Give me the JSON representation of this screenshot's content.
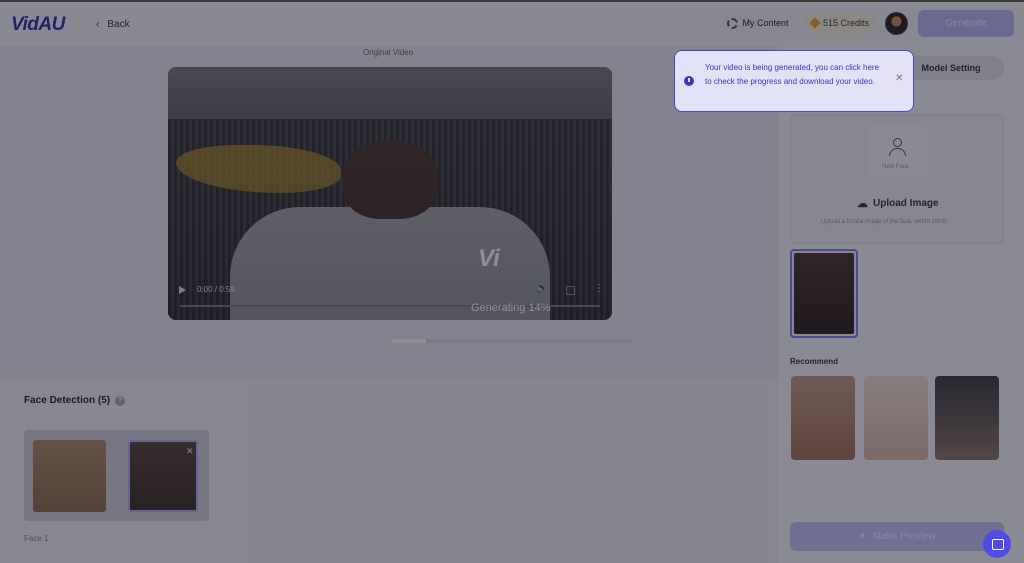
{
  "header": {
    "logo": "VidAU",
    "back_label": "Back",
    "my_content_label": "My Content",
    "credits_label": "515 Credits",
    "generate_label": "Generate"
  },
  "main": {
    "original_video_label": "Original Video",
    "video": {
      "time": "0:00 / 0:59",
      "overlay_logo": "Vi",
      "generating_text": "Generating 14%",
      "progress": 0.14
    },
    "face_detection": {
      "title": "Face Detection (5)",
      "face_label": "Face 1"
    }
  },
  "right_panel": {
    "tab_label": "Model Setting",
    "new_face_label": "New Face",
    "upload_label": "Upload Image",
    "upload_hint": "Upload a frontal image of the face, within 10mb",
    "recommend_label": "Recommend",
    "make_preview_label": "Make Preview"
  },
  "toast": {
    "message": "Your video is being generated, you can click here to check the progress and download your video."
  },
  "colors": {
    "brand": "#2d2fa6",
    "accent": "#4f4ce4",
    "toast_bg": "#e2e1f6",
    "overlay": "rgba(20,20,40,0.48)"
  }
}
